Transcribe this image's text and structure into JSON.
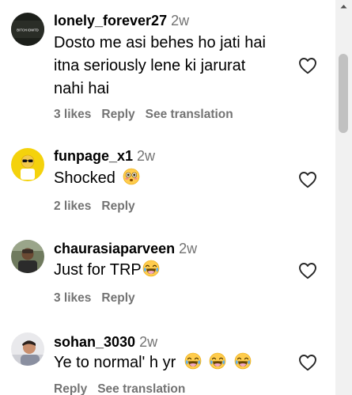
{
  "comments": [
    {
      "username": "lonely_forever27",
      "time": "2w",
      "text_lines": [
        "Dosto me asi behes ho jati hai",
        "itna seriously lene ki jarurat",
        "nahi hai"
      ],
      "likes": "3 likes",
      "reply": "Reply",
      "translation": "See translation",
      "avatar_text": "BITCH IDWTD"
    },
    {
      "username": "funpage_x1",
      "time": "2w",
      "text": "Shocked",
      "likes": "2 likes",
      "reply": "Reply"
    },
    {
      "username": "chaurasiaparveen",
      "time": "2w",
      "text": "Just for TRP",
      "likes": "3 likes",
      "reply": "Reply"
    },
    {
      "username": "sohan_3030",
      "time": "2w",
      "text": "Ye to normal' h yr",
      "reply": "Reply",
      "translation": "See translation"
    }
  ],
  "icons": {
    "like": "heart-outline-icon",
    "scroll": "scroll-up-arrow-icon"
  },
  "colors": {
    "secondary_text": "#737373",
    "scroll_track": "#f1f1f1",
    "scroll_thumb": "#c1c1c1"
  }
}
